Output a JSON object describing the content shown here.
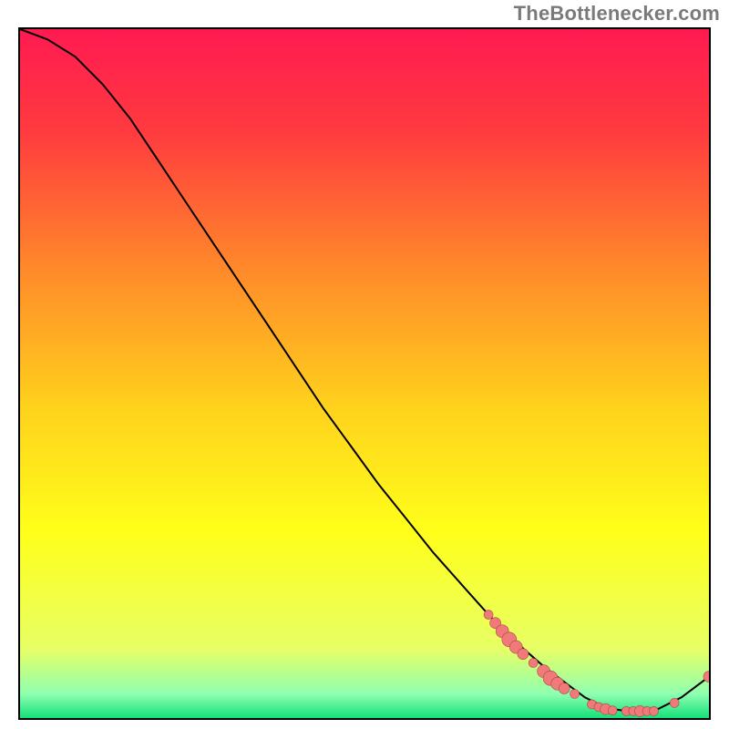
{
  "attribution": "TheBottlenecker.com",
  "chart_data": {
    "type": "line",
    "title": "",
    "xlabel": "",
    "ylabel": "",
    "xlim": [
      0,
      100
    ],
    "ylim": [
      0,
      100
    ],
    "legend": false,
    "grid": false,
    "background_gradient": {
      "stops": [
        {
          "offset": 0.0,
          "color": "#ff1a51"
        },
        {
          "offset": 0.15,
          "color": "#ff3b3f"
        },
        {
          "offset": 0.35,
          "color": "#ff8a2a"
        },
        {
          "offset": 0.55,
          "color": "#ffd21c"
        },
        {
          "offset": 0.73,
          "color": "#ffff1a"
        },
        {
          "offset": 0.9,
          "color": "#e7ff66"
        },
        {
          "offset": 0.965,
          "color": "#8fffb0"
        },
        {
          "offset": 1.0,
          "color": "#14e07a"
        }
      ]
    },
    "series": [
      {
        "name": "bottleneck-curve",
        "color": "#000000",
        "x": [
          0,
          4,
          8,
          12,
          16,
          20,
          24,
          28,
          32,
          36,
          40,
          44,
          48,
          52,
          56,
          60,
          64,
          68,
          72,
          76,
          80,
          82,
          85,
          88,
          92,
          96,
          100
        ],
        "y": [
          100,
          98.5,
          96,
          92,
          87,
          81,
          75,
          69,
          63,
          57,
          51,
          45,
          39.5,
          34,
          29,
          24,
          19.5,
          15,
          11,
          7.5,
          4.5,
          3,
          1.5,
          1,
          1,
          3,
          6
        ]
      }
    ],
    "markers": {
      "name": "bottleneck-points",
      "color": "#f07a7a",
      "stroke": "#b04545",
      "series_ref": "bottleneck-curve",
      "points": [
        {
          "x": 68,
          "y": 15,
          "r": 5
        },
        {
          "x": 69,
          "y": 13.8,
          "r": 6
        },
        {
          "x": 70,
          "y": 12.6,
          "r": 7
        },
        {
          "x": 71,
          "y": 11.4,
          "r": 8
        },
        {
          "x": 72,
          "y": 10.3,
          "r": 7
        },
        {
          "x": 73,
          "y": 9.3,
          "r": 6
        },
        {
          "x": 74.5,
          "y": 8,
          "r": 5
        },
        {
          "x": 76,
          "y": 6.8,
          "r": 7
        },
        {
          "x": 77,
          "y": 5.8,
          "r": 8
        },
        {
          "x": 78,
          "y": 5,
          "r": 7
        },
        {
          "x": 79,
          "y": 4.3,
          "r": 6
        },
        {
          "x": 80.5,
          "y": 3.5,
          "r": 5
        },
        {
          "x": 83,
          "y": 2,
          "r": 5
        },
        {
          "x": 84,
          "y": 1.6,
          "r": 5
        },
        {
          "x": 85,
          "y": 1.3,
          "r": 6
        },
        {
          "x": 86,
          "y": 1.1,
          "r": 5
        },
        {
          "x": 88,
          "y": 1,
          "r": 5
        },
        {
          "x": 89,
          "y": 1,
          "r": 5
        },
        {
          "x": 90,
          "y": 1,
          "r": 6
        },
        {
          "x": 91,
          "y": 1,
          "r": 5
        },
        {
          "x": 92,
          "y": 1,
          "r": 5
        },
        {
          "x": 95,
          "y": 2.2,
          "r": 5
        },
        {
          "x": 100,
          "y": 6,
          "r": 6
        }
      ]
    }
  }
}
